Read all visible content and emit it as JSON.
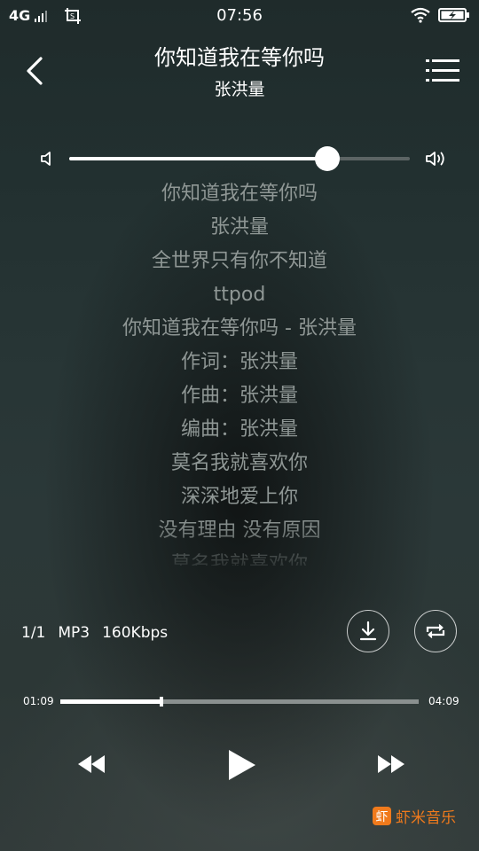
{
  "status_bar": {
    "network": "4G",
    "time": "07:56",
    "icons": [
      "signal-icon",
      "screenshot-crop-icon",
      "wifi-icon",
      "battery-charging-icon"
    ]
  },
  "header": {
    "back_icon": "chevron-left-icon",
    "title": "你知道我在等你吗",
    "artist": "张洪量",
    "menu_icon": "playlist-menu-icon"
  },
  "volume": {
    "level": 0.758,
    "mute_icon": "volume-low-icon",
    "max_icon": "volume-high-icon"
  },
  "lyrics": [
    "你知道我在等你吗",
    "张洪量",
    "全世界只有你不知道",
    "ttpod",
    "你知道我在等你吗 - 张洪量",
    "作词：张洪量",
    "作曲：张洪量",
    "编曲：张洪量",
    "莫名我就喜欢你",
    "深深地爱上你",
    "没有理由 没有原因",
    "莫名我就喜欢你"
  ],
  "track_info": {
    "index": "1/1",
    "format": "MP3",
    "bitrate": "160Kbps",
    "download_icon": "download-icon",
    "repeat_icon": "repeat-icon"
  },
  "playback": {
    "current_time": "01:09",
    "total_time": "04:09",
    "progress": 0.2811
  },
  "controls": {
    "prev_icon": "rewind-icon",
    "play_icon": "play-icon",
    "next_icon": "fast-forward-icon"
  },
  "brand": {
    "name": "虾米音乐",
    "logo_char": "虾",
    "color": "#f07a1c"
  }
}
